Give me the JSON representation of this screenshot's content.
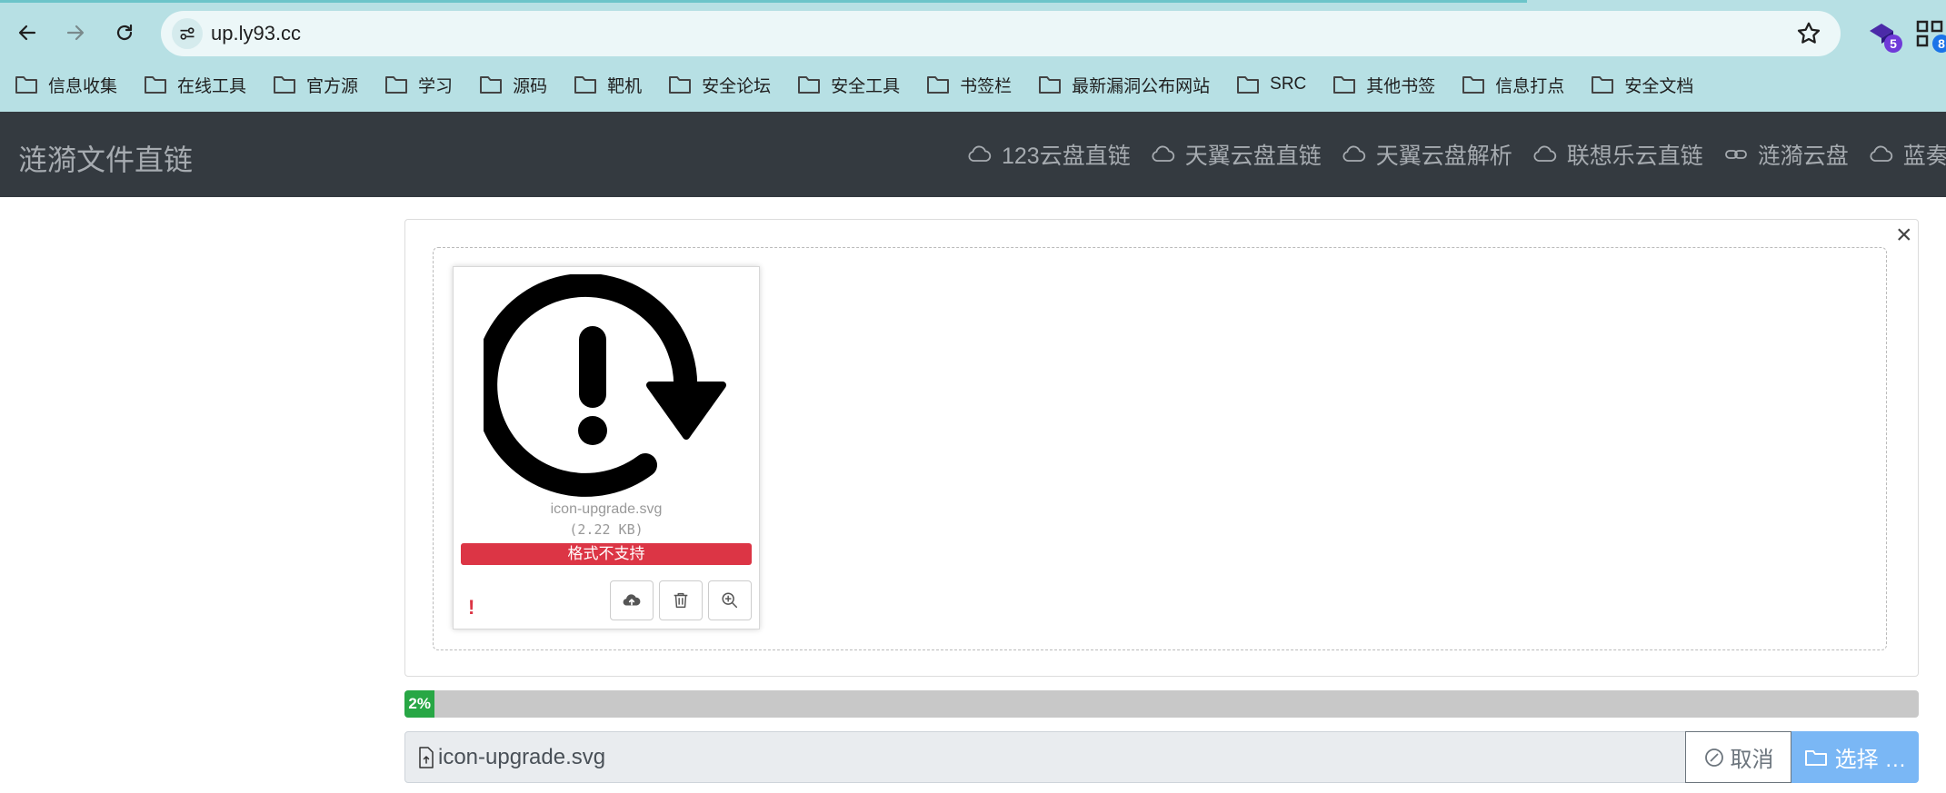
{
  "browser": {
    "url": "up.ly93.cc",
    "extensions": [
      {
        "icon": "extension-gem-icon",
        "badge": "5",
        "badge_color": "#6f3ad8"
      },
      {
        "icon": "extension-qr-icon",
        "badge": "8",
        "badge_color": "#1a73e8"
      }
    ],
    "bookmarks": [
      "信息收集",
      "在线工具",
      "官方源",
      "学习",
      "源码",
      "靶机",
      "安全论坛",
      "安全工具",
      "书签栏",
      "最新漏洞公布网站",
      "SRC",
      "其他书签",
      "信息打点",
      "安全文档"
    ]
  },
  "site": {
    "brand": "涟漪文件直链",
    "nav": [
      {
        "label": "123云盘直链",
        "icon": "cloud-icon"
      },
      {
        "label": "天翼云盘直链",
        "icon": "cloud-icon"
      },
      {
        "label": "天翼云盘解析",
        "icon": "cloud-icon"
      },
      {
        "label": "联想乐云直链",
        "icon": "cloud-icon"
      },
      {
        "label": "涟漪云盘",
        "icon": "link-icon"
      },
      {
        "label": "蓝奏云",
        "icon": "cloud-icon"
      }
    ]
  },
  "upload": {
    "close_label": "×",
    "file": {
      "name": "icon-upgrade.svg",
      "size": "(2.22 KB)",
      "status": "格式不支持",
      "warning": "!"
    },
    "progress": {
      "percent": 2,
      "label": "2%"
    },
    "caption": "icon-upgrade.svg",
    "cancel_label": "取消",
    "browse_label": "选择 …"
  },
  "colors": {
    "chrome_bg": "#b7e0e4",
    "header_bg": "#343a40",
    "error": "#dc3545",
    "success": "#28a745",
    "primary_light": "#7ab7f5"
  }
}
